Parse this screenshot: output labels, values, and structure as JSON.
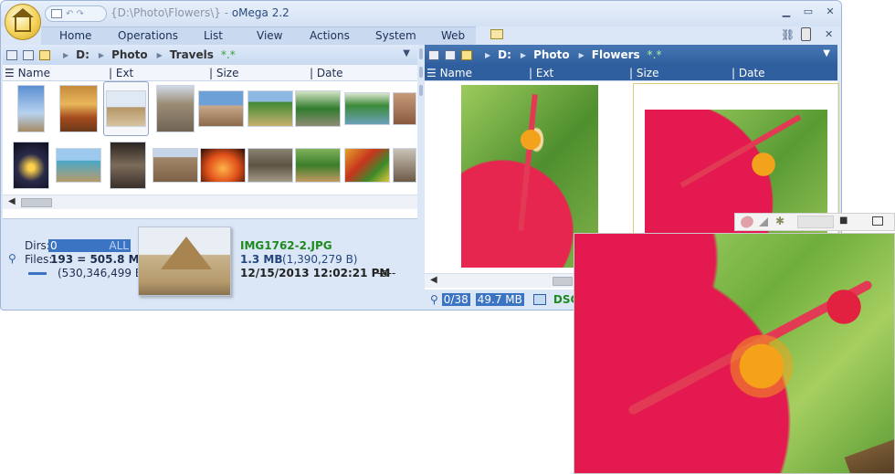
{
  "window": {
    "title_path": "{D:\\Photo\\Flowers\\}",
    "title_sep": " - ",
    "app_name": "oMega 2.2",
    "qat_undo": "↶ ↷"
  },
  "menu": [
    "Home",
    "Operations",
    "List",
    "View",
    "Actions",
    "System",
    "Web"
  ],
  "left_panel": {
    "path": [
      "D:",
      "Photo",
      "Travels"
    ],
    "mask": "*.*",
    "columns": [
      "Name",
      "Ext",
      "Size",
      "Date"
    ]
  },
  "right_panel": {
    "path": [
      "D:",
      "Photo",
      "Flowers"
    ],
    "mask": "*.*",
    "columns": [
      "Name",
      "Ext",
      "Size",
      "Date"
    ]
  },
  "info": {
    "dirs_label": "Dirs:",
    "dirs_value": "0",
    "dirs_all": "ALL",
    "files_label": "Files:",
    "files_value": "193 = 505.8 MB",
    "files_bytes": "(530,346,499 B)",
    "file_name": "IMG1762-2.JPG",
    "file_size": "1.3 MB",
    "file_size_bytes": "(1,390,279 B)",
    "file_date": "12/15/2013 12:02:21 PM",
    "file_attr": "-a--"
  },
  "right_status": {
    "count": "0/38",
    "size": "49.7 MB",
    "name_partial": "DSC"
  },
  "colors": {
    "accent": "#2f5f9e",
    "panel_bg": "#dbe7f7",
    "highlight": "#3c74c4",
    "green": "#1d8a1d",
    "flower_red": "#e3194f"
  }
}
